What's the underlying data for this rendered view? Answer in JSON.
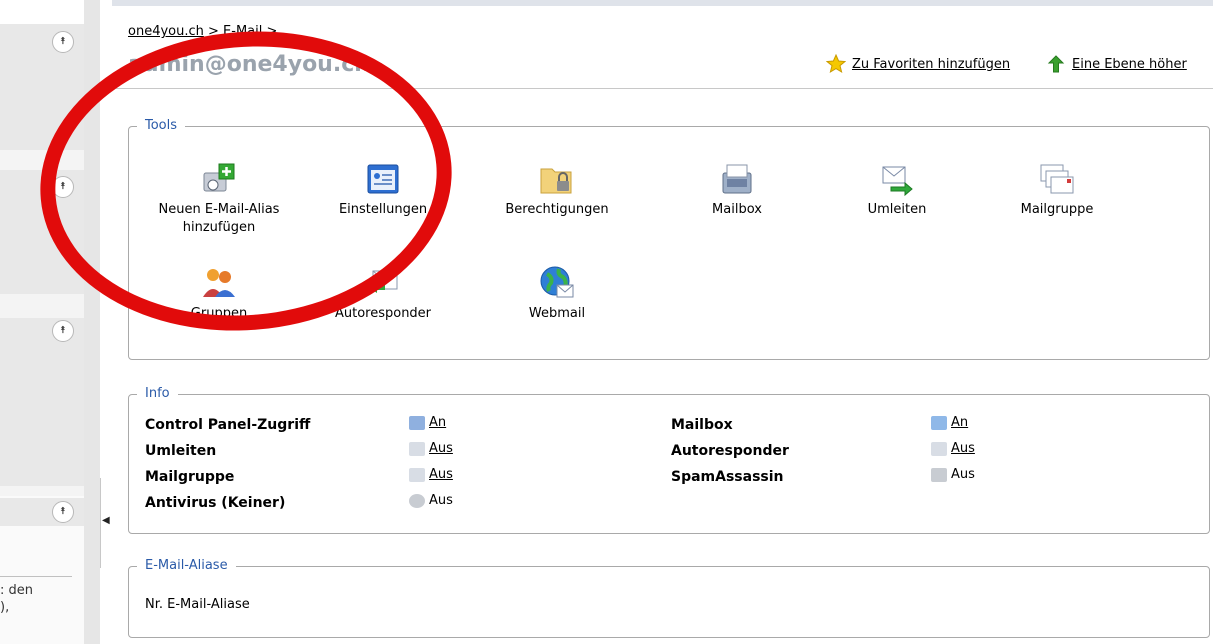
{
  "sidebar": {
    "footer_text": ": den\n),"
  },
  "breadcrumb": {
    "part1": "one4you.ch",
    "sep": " > ",
    "part2": "E-Mail",
    "tail": " >"
  },
  "page_title": "admin@one4you.ch",
  "header_links": {
    "favorites": "Zu Favoriten hinzufügen",
    "up_level": "Eine Ebene höher"
  },
  "tools": {
    "legend": "Tools",
    "items": [
      {
        "label": "Neuen E-Mail-Alias hinzufügen",
        "icon": "add-email-alias-icon"
      },
      {
        "label": "Einstellungen",
        "icon": "settings-window-icon"
      },
      {
        "label": "Berechtigungen",
        "icon": "permissions-folder-lock-icon"
      },
      {
        "label": "Mailbox",
        "icon": "mailbox-icon"
      },
      {
        "label": "Umleiten",
        "icon": "redirect-icon"
      },
      {
        "label": "Mailgruppe",
        "icon": "mailgroup-icon"
      },
      {
        "label": "Gruppen",
        "icon": "groups-icon"
      },
      {
        "label": "Autoresponder",
        "icon": "autoresponder-icon"
      },
      {
        "label": "Webmail",
        "icon": "webmail-globe-icon"
      }
    ]
  },
  "info": {
    "legend": "Info",
    "rows": [
      {
        "label": "Control Panel-Zugriff",
        "value": "An",
        "link": true
      },
      {
        "label": "Umleiten",
        "value": "Aus",
        "link": true
      },
      {
        "label": "Mailgruppe",
        "value": "Aus",
        "link": true
      },
      {
        "label": "Antivirus (Keiner)",
        "value": "Aus",
        "link": false
      },
      {
        "label": "Mailbox",
        "value": "An",
        "link": true
      },
      {
        "label": "Autoresponder",
        "value": "Aus",
        "link": true
      },
      {
        "label": "SpamAssassin",
        "value": "Aus",
        "link": false
      }
    ]
  },
  "aliases": {
    "legend": "E-Mail-Aliase",
    "header": "Nr. E-Mail-Aliase"
  },
  "colors": {
    "legend_blue": "#2a5aa8",
    "annotation_red": "#e10b0b"
  }
}
